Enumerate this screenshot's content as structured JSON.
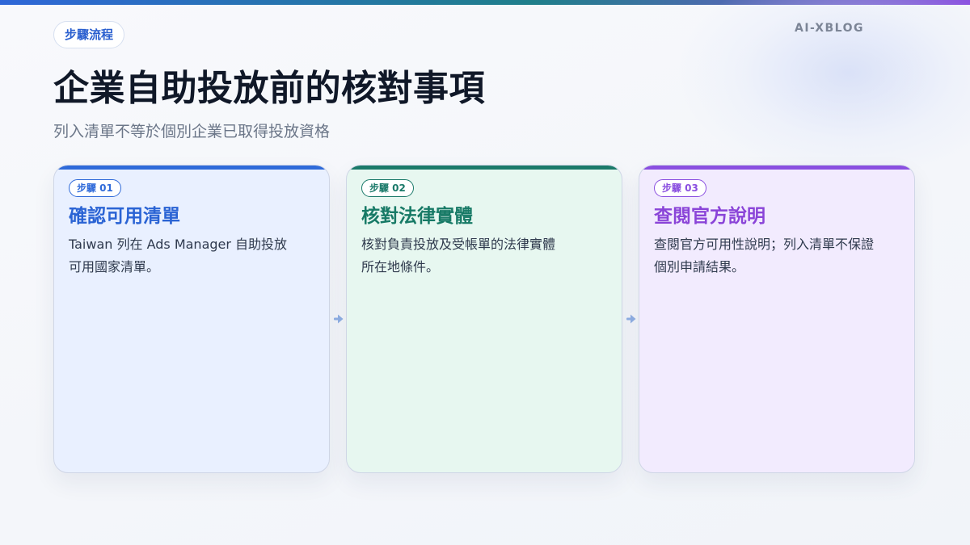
{
  "header": {
    "tag": "步驟流程",
    "brand": "AI-XBLOG",
    "title": "企業自助投放前的核對事項",
    "subtitle": "列入清單不等於個別企業已取得投放資格"
  },
  "steps": [
    {
      "badge": "步驟 01",
      "title": "確認可用清單",
      "body_lines": [
        "Taiwan 列在 Ads Manager 自助投放",
        "可用國家清單。"
      ],
      "color": "#2f6ad9"
    },
    {
      "badge": "步驟 02",
      "title": "核對法律實體",
      "body_lines": [
        "核對負責投放及受帳單的法律實體",
        "所在地條件。"
      ],
      "color": "#1b7a6a"
    },
    {
      "badge": "步驟 03",
      "title": "查閱官方說明",
      "body_lines": [
        "查閱官方可用性說明；列入清單不保證",
        "個別申請結果。"
      ],
      "color": "#8a4fe0"
    }
  ],
  "icons": {
    "connector": "arrow-right-icon"
  }
}
